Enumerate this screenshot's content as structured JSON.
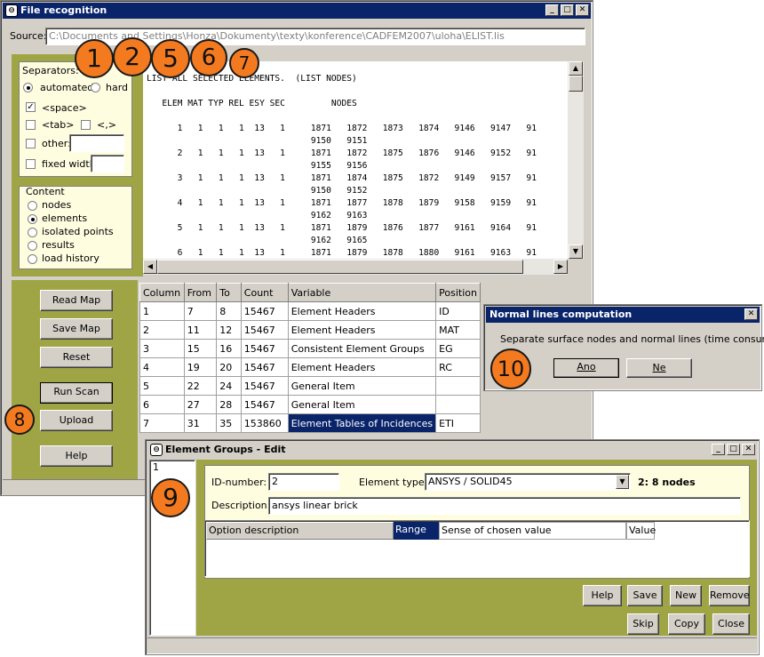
{
  "fr": {
    "title": "File recognition",
    "source_label": "Source:",
    "source_path": "C:\\Documents and Settings\\Honza\\Dokumenty\\texty\\konference\\CADFEM2007\\uloha\\ELIST.lis",
    "separators": {
      "legend": "Separators:",
      "automated": "automated",
      "hard": "hard",
      "space": "<space>",
      "tab": "<tab>",
      "comma": "<,>",
      "other": "other:",
      "fixed": "fixed width:"
    },
    "content": {
      "legend": "Content",
      "items": [
        "nodes",
        "elements",
        "isolated points",
        "results",
        "load history"
      ],
      "selected": 1
    },
    "listing": [
      "LIST ALL SELECTED ELEMENTS.  (LIST NODES)",
      "",
      "   ELEM MAT TYP REL ESY SEC         NODES",
      "",
      "      1   1   1   1  13   1     1871   1872   1873   1874   9146   9147   91",
      "                                9150   9151",
      "      2   1   1   1  13   1     1871   1872   1875   1876   9146   9152   91",
      "                                9155   9156",
      "      3   1   1   1  13   1     1871   1874   1875   1872   9149   9157   91",
      "                                9150   9152",
      "      4   1   1   1  13   1     1871   1877   1878   1879   9158   9159   91",
      "                                9162   9163",
      "      5   1   1   1  13   1     1871   1879   1876   1877   9161   9164   91",
      "                                9162   9165",
      "      6   1   1   1  13   1     1871   1879   1878   1880   9161   9163   91"
    ],
    "buttons": {
      "read_map": "Read Map",
      "save_map": "Save Map",
      "reset": "Reset",
      "run_scan": "Run Scan",
      "upload": "Upload",
      "help": "Help"
    },
    "table": {
      "headers": [
        "Column",
        "From",
        "To",
        "Count",
        "Variable",
        "Position"
      ],
      "rows": [
        [
          "1",
          "7",
          "8",
          "15467",
          "Element Headers",
          "ID"
        ],
        [
          "2",
          "11",
          "12",
          "15467",
          "Element Headers",
          "MAT"
        ],
        [
          "3",
          "15",
          "16",
          "15467",
          "Consistent Element Groups",
          "EG"
        ],
        [
          "4",
          "19",
          "20",
          "15467",
          "Element Headers",
          "RC"
        ],
        [
          "5",
          "22",
          "24",
          "15467",
          "General Item",
          ""
        ],
        [
          "6",
          "27",
          "28",
          "15467",
          "General Item",
          ""
        ],
        [
          "7",
          "31",
          "35",
          "153860",
          "Element Tables of Incidences",
          "ETI"
        ]
      ]
    }
  },
  "nl": {
    "title": "Normal lines computation",
    "message": "Separate surface nodes and normal lines (time consuming)?",
    "yes": "Ano",
    "no": "Ne"
  },
  "eg": {
    "title": "Element Groups - Edit",
    "list_item": "1",
    "id_label": "ID-number:",
    "id_value": "2",
    "type_label": "Element type:",
    "type_value": "ANSYS / SOLID45",
    "nodes_info": "2: 8 nodes",
    "desc_label": "Description:",
    "desc_value": "ansys linear brick",
    "headers": [
      "Option description",
      "Range",
      "Sense of chosen value",
      "Value"
    ],
    "buttons": {
      "help": "Help",
      "save": "Save",
      "new": "New",
      "remove": "Remove",
      "skip": "Skip",
      "copy": "Copy",
      "close": "Close"
    }
  },
  "callouts": [
    "1",
    "2",
    "5",
    "6",
    "7",
    "8",
    "9",
    "10"
  ],
  "colors": {
    "accent": "#f47a20",
    "panel_green": "#9fa545",
    "title_active": "#0a246a"
  },
  "icons": [
    "app-icon",
    "minimize-icon",
    "maximize-icon",
    "close-icon",
    "radio-icon",
    "checkbox-icon",
    "scroll-arrow-icon",
    "dropdown-arrow-icon"
  ]
}
